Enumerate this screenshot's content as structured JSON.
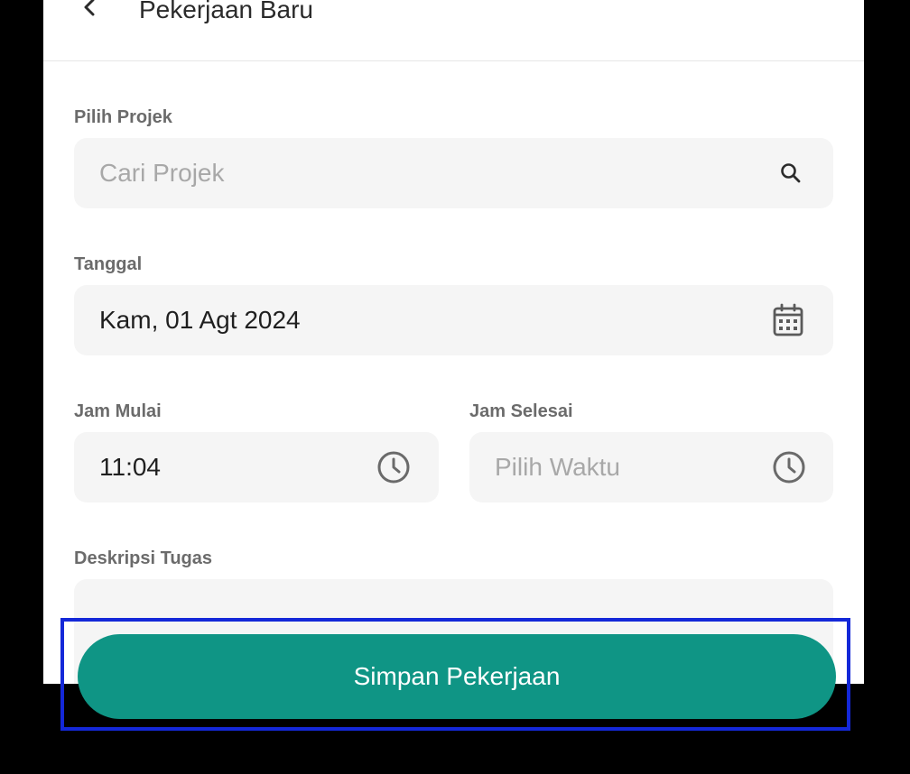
{
  "header": {
    "title": "Pekerjaan Baru",
    "back_icon": "chevron-left-icon"
  },
  "project": {
    "label": "Pilih Projek",
    "placeholder": "Cari Projek",
    "icon": "search-icon"
  },
  "date": {
    "label": "Tanggal",
    "value": "Kam, 01 Agt 2024",
    "icon": "calendar-icon"
  },
  "start_time": {
    "label": "Jam Mulai",
    "value": "11:04",
    "icon": "clock-icon"
  },
  "end_time": {
    "label": "Jam Selesai",
    "placeholder": "Pilih Waktu",
    "icon": "clock-icon"
  },
  "description": {
    "label": "Deskripsi Tugas",
    "value": ""
  },
  "actions": {
    "save_label": "Simpan Pekerjaan"
  },
  "colors": {
    "primary": "#0f9585",
    "field_background": "#f5f5f5",
    "highlight_border": "#1428d8",
    "label_text": "#6b6b6b",
    "placeholder_text": "#a8a8a8"
  }
}
